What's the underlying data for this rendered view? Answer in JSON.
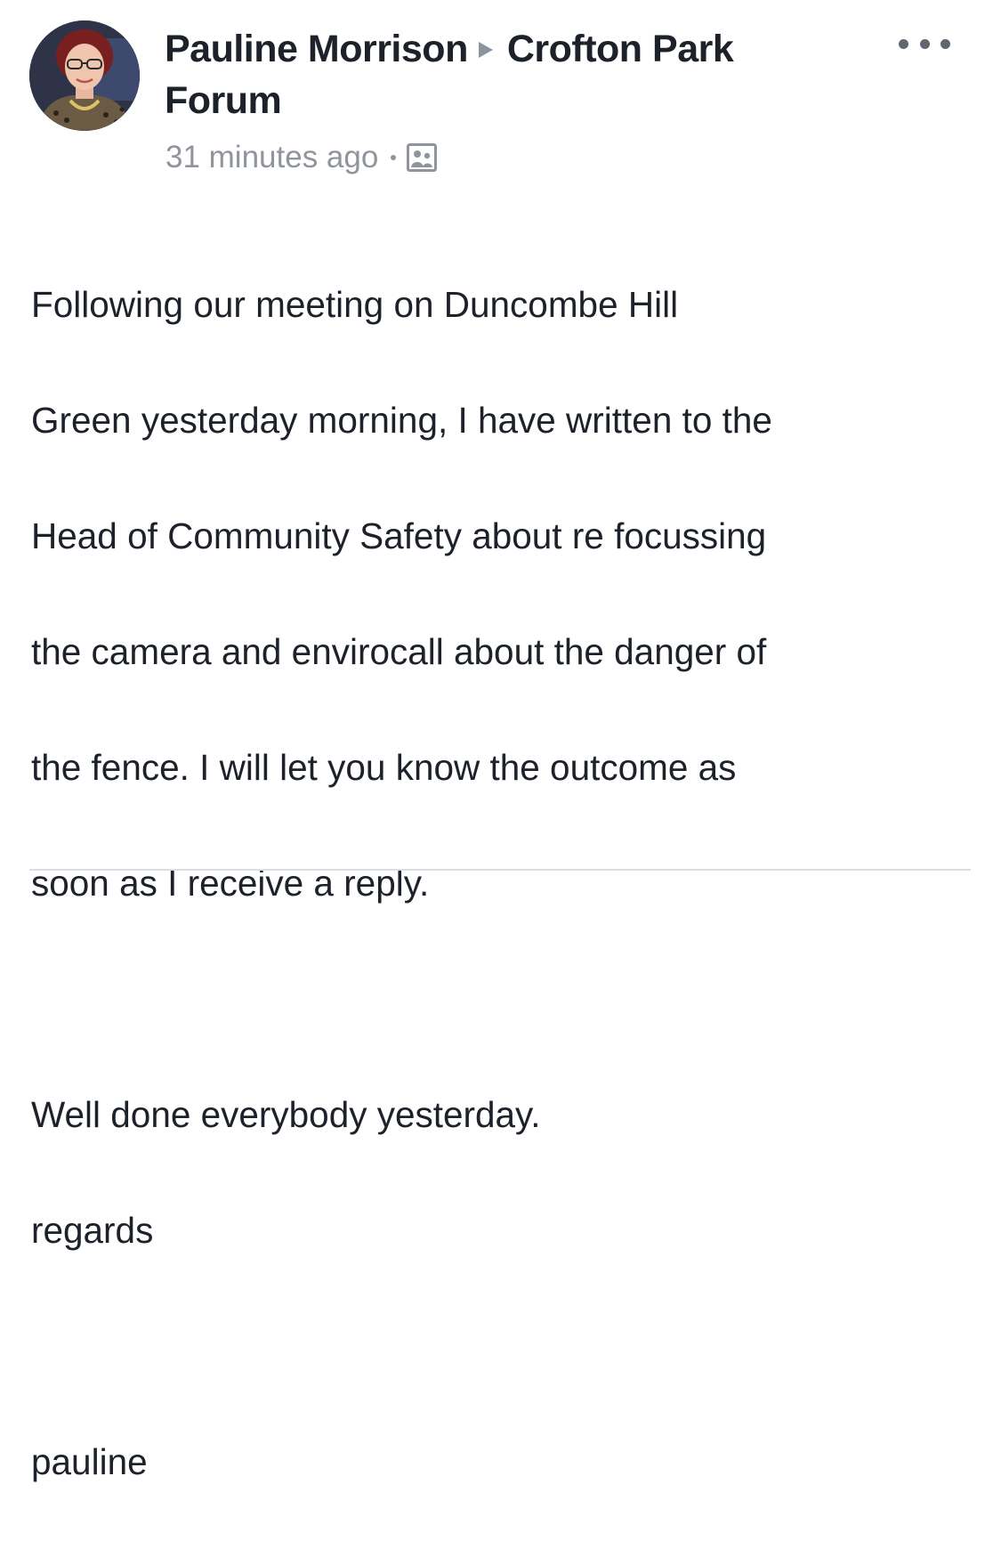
{
  "post": {
    "author": "Pauline Morrison",
    "group": "Crofton Park Forum",
    "timestamp": "31 minutes ago",
    "audience_icon": "group-audience-icon",
    "more_icon": "more-options-icon",
    "body": [
      "Following  our meeting on Duncombe Hill",
      "Green yesterday morning, I have written to the",
      "Head of Community Safety about re focussing",
      "the camera and envirocall about the danger of",
      "the fence. I will let you know the outcome as",
      "soon as I receive a reply.",
      "",
      "Well done everybody yesterday.",
      "regards",
      "",
      "pauline"
    ]
  },
  "colors": {
    "text": "#1d2129",
    "meta": "#90949c",
    "arrow": "#8d949e",
    "divider": "#dadde1"
  }
}
